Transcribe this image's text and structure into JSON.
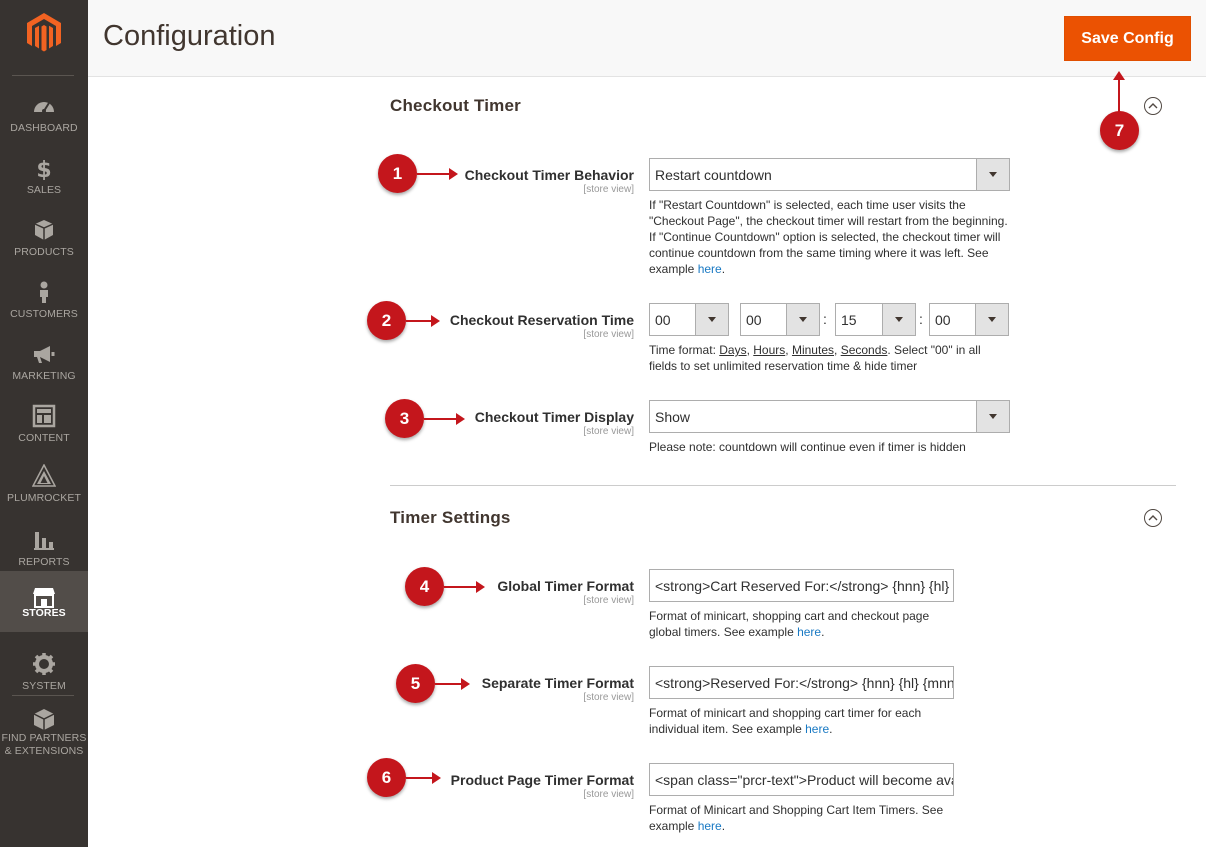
{
  "sidebar": {
    "logo": "magento-logo",
    "items": [
      {
        "label": "DASHBOARD",
        "icon": "dashboard-icon"
      },
      {
        "label": "SALES",
        "icon": "dollar-icon"
      },
      {
        "label": "PRODUCTS",
        "icon": "box-icon"
      },
      {
        "label": "CUSTOMERS",
        "icon": "person-icon"
      },
      {
        "label": "MARKETING",
        "icon": "megaphone-icon"
      },
      {
        "label": "CONTENT",
        "icon": "layout-icon"
      },
      {
        "label": "PLUMROCKET",
        "icon": "plumrocket-icon"
      },
      {
        "label": "REPORTS",
        "icon": "bar-chart-icon"
      },
      {
        "label": "STORES",
        "icon": "store-icon",
        "active": true
      },
      {
        "label": "SYSTEM",
        "icon": "gear-icon"
      },
      {
        "label1": "FIND PARTNERS",
        "label2": "& EXTENSIONS",
        "icon": "partners-icon"
      }
    ]
  },
  "header": {
    "title": "Configuration",
    "save_label": "Save Config"
  },
  "sections": {
    "checkout_timer": {
      "title": "Checkout Timer",
      "behavior": {
        "label": "Checkout Timer Behavior",
        "scope": "[store view]",
        "value": "Restart countdown",
        "note": "If \"Restart Countdown\" is selected, each time user visits the \"Checkout Page\", the checkout timer will restart from the beginning. If \"Continue Countdown\" option is selected, the checkout timer will continue countdown from the same timing where it was left. See example ",
        "link": "here"
      },
      "reservation": {
        "label": "Checkout Reservation Time",
        "scope": "[store view]",
        "days": "00",
        "hours": "00",
        "minutes": "15",
        "seconds": "00",
        "separator": ":",
        "note_prefix": "Time format: ",
        "unit_days": "Days",
        "unit_hours": "Hours",
        "unit_minutes": "Minutes",
        "unit_seconds": "Seconds",
        "comma": ",",
        "note_suffix": ". Select \"00\" in all fields to set unlimited reservation time & hide timer"
      },
      "display": {
        "label": "Checkout Timer Display",
        "scope": "[store view]",
        "value": "Show",
        "note": "Please note: countdown will continue even if timer is hidden"
      }
    },
    "timer_settings": {
      "title": "Timer Settings",
      "global_format": {
        "label": "Global Timer Format",
        "scope": "[store view]",
        "value": "<strong>Cart Reserved For:</strong> {hnn} {hl} {mnn} {ml} {snn} {sl}",
        "note": "Format of minicart, shopping cart and checkout page global timers. See example ",
        "link": "here"
      },
      "separate_format": {
        "label": "Separate Timer Format",
        "scope": "[store view]",
        "value": "<strong>Reserved For:</strong> {hnn} {hl} {mnn} {ml}",
        "note": "Format of minicart and shopping cart timer for each individual item. See example ",
        "link": "here"
      },
      "product_format": {
        "label": "Product Page Timer Format",
        "scope": "[store view]",
        "value": "<span class=\"prcr-text\">Product will become available in",
        "note": "Format of Minicart and Shopping Cart Item Timers. See example ",
        "link": "here"
      }
    }
  },
  "annotations": [
    "1",
    "2",
    "3",
    "4",
    "5",
    "6",
    "7"
  ],
  "colors": {
    "accent": "#eb5202",
    "badge": "#c4161c",
    "link": "#1979c3",
    "sidebar": "#373330"
  },
  "link_end": "."
}
